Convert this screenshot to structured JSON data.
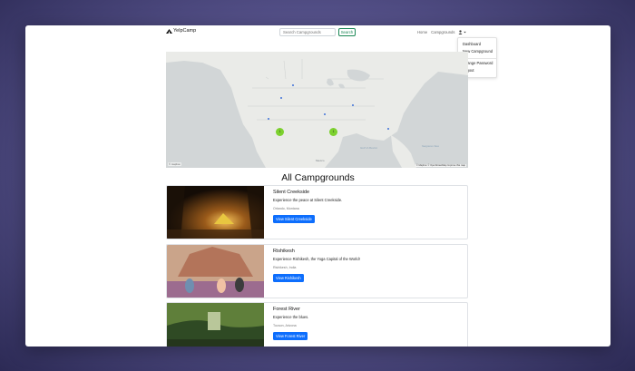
{
  "nav": {
    "brand": "YelpCamp",
    "search_placeholder": "Search Campgrounds",
    "search_button": "Search",
    "links": [
      "Home",
      "Campgrounds"
    ],
    "dropdown": {
      "items": [
        "Dashboard",
        "New Campground"
      ],
      "items2": [
        "Change Password",
        "Logout"
      ]
    }
  },
  "map": {
    "clusters": [
      "1",
      "1"
    ],
    "labels": [
      "Gulf of Mexico",
      "Sargasso Sea",
      "Mexico"
    ],
    "attribution": "© Mapbox © OpenStreetMap  Improve this map",
    "logo": "© mapbox"
  },
  "main": {
    "heading": "All Campgrounds",
    "campgrounds": [
      {
        "title": "Silent Creekside",
        "description": "Experience the peace at Silent Creekside.",
        "location": "Orlando, Montana",
        "button": "View Silent Creekside"
      },
      {
        "title": "Rishikesh",
        "description": "Experience Rishikesh, the Yoga Capital of the World!",
        "location": "Rishikesh, India",
        "button": "View Rishikesh"
      },
      {
        "title": "Forest River",
        "description": "Experience the blues.",
        "location": "Tucson, Arizona",
        "button": "View Forest River"
      }
    ]
  },
  "colors": {
    "primary": "#0d6efd",
    "success": "#198754",
    "cluster": "#7dd12e",
    "background": "#4a4680"
  }
}
